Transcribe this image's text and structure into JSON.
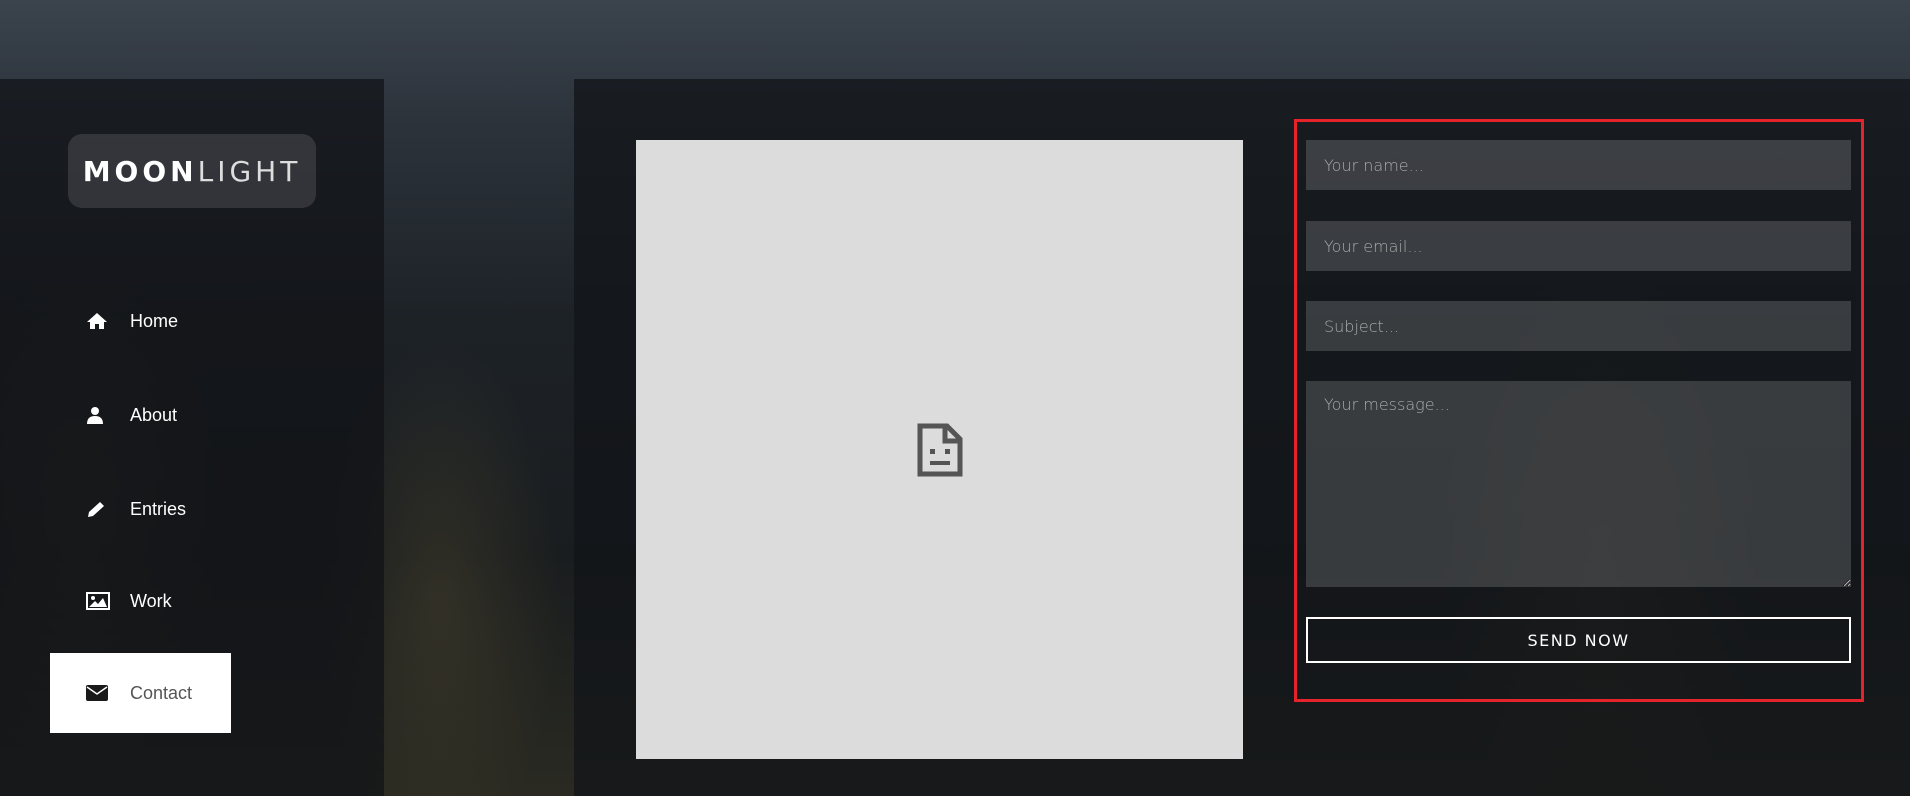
{
  "logo": {
    "bold": "MOON",
    "light": "LIGHT"
  },
  "nav": [
    {
      "label": "Home",
      "icon": "home-icon"
    },
    {
      "label": "About",
      "icon": "user-icon"
    },
    {
      "label": "Entries",
      "icon": "pencil-icon"
    },
    {
      "label": "Work",
      "icon": "image-icon"
    },
    {
      "label": "Contact",
      "icon": "envelope-icon",
      "active": true
    }
  ],
  "map": {
    "status": "broken-image-icon"
  },
  "form": {
    "name_placeholder": "Your name...",
    "email_placeholder": "Your email...",
    "subject_placeholder": "Subject...",
    "message_placeholder": "Your message...",
    "submit_label": "SEND NOW"
  },
  "colors": {
    "highlight": "#e5232a",
    "active_bg": "#ffffff"
  }
}
